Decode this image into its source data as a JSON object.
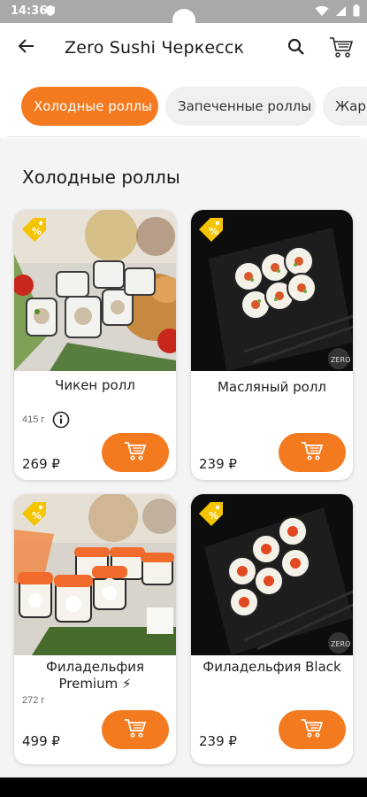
{
  "status_bar": {
    "time": "14:36"
  },
  "app_bar": {
    "title": "Zero Sushi Черкесск"
  },
  "tabs": [
    {
      "label": "Холодные роллы",
      "active": true
    },
    {
      "label": "Запеченные роллы",
      "active": false
    },
    {
      "label": "Жар",
      "active": false
    }
  ],
  "section": {
    "title": "Холодные роллы"
  },
  "products": [
    {
      "name": "Чикен ролл",
      "weight": "415 г",
      "price": "269 ₽"
    },
    {
      "name": "Масляный ролл",
      "weight": "",
      "price": "239 ₽"
    },
    {
      "name": "Филадельфия Premium ⚡",
      "weight": "272 г",
      "price": "499 ₽"
    },
    {
      "name": "Филадельфия Black",
      "weight": "",
      "price": "239 ₽"
    }
  ],
  "colors": {
    "accent": "#f47a1f",
    "status_bar": "#a9a9a9"
  },
  "icons": {
    "back": "arrow-left-icon",
    "search": "search-icon",
    "cart": "cart-icon",
    "promo": "discount-tag-icon",
    "info": "info-icon",
    "add_to_cart": "cart-icon"
  }
}
